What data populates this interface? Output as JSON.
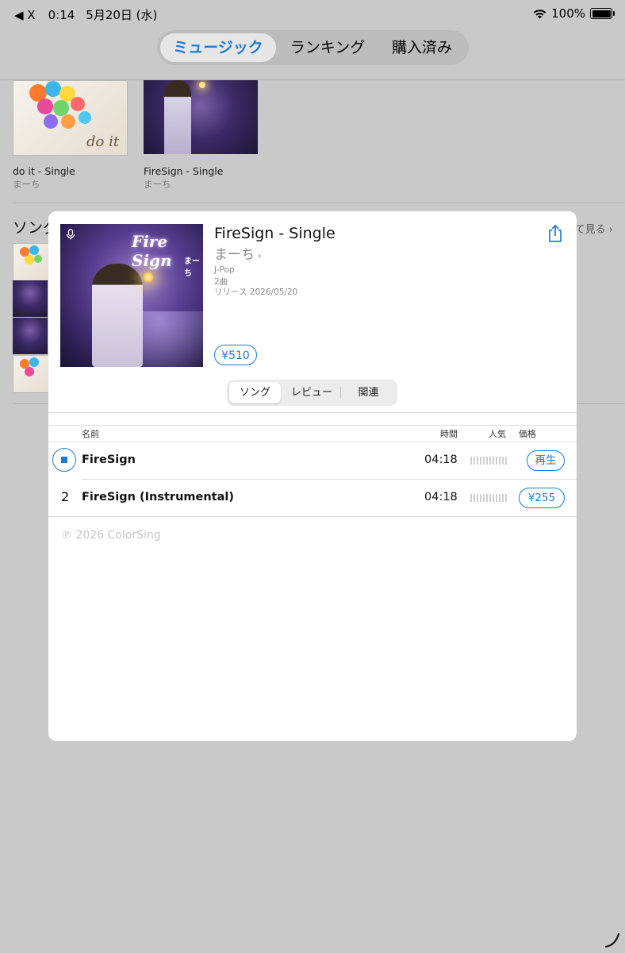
{
  "status_bar": {
    "back_label": "◀ X",
    "time": "0:14",
    "date": "5月20日 (水)",
    "battery": "100%"
  },
  "top_tabs": [
    {
      "label": "ミュージック",
      "active": true
    },
    {
      "label": "ランキング",
      "active": false
    },
    {
      "label": "購入済み",
      "active": false
    }
  ],
  "background": {
    "albums": [
      {
        "title": "do it - Single",
        "artist": "まーち",
        "cover_text": "do it"
      },
      {
        "title": "FireSign - Single",
        "artist": "まーち"
      }
    ],
    "songs_section_label": "ソング",
    "see_all_label": "すべて見る"
  },
  "modal": {
    "title": "FireSign - Single",
    "artist": "まーち",
    "cover_title": "Fire Sign",
    "cover_artist": "まーち",
    "genre": "J-Pop",
    "track_count": "2曲",
    "release": "リリース 2026/05/20",
    "price": "¥510",
    "tabs": [
      {
        "label": "ソング",
        "active": true
      },
      {
        "label": "レビュー",
        "active": false
      },
      {
        "label": "関連",
        "active": false
      }
    ],
    "columns": {
      "name": "名前",
      "time": "時間",
      "popularity": "人気",
      "price": "価格"
    },
    "tracks": [
      {
        "number": "1",
        "name": "FireSign",
        "time": "04:18",
        "popularity": 0,
        "action": "再生",
        "playing": true
      },
      {
        "number": "2",
        "name": "FireSign (Instrumental)",
        "time": "04:18",
        "popularity": 0,
        "action": "¥255",
        "playing": false
      }
    ],
    "copyright": "℗ 2026 ColorSing"
  },
  "colors": {
    "accent": "#1a7bd6",
    "overlay": "#c9c9c9"
  }
}
